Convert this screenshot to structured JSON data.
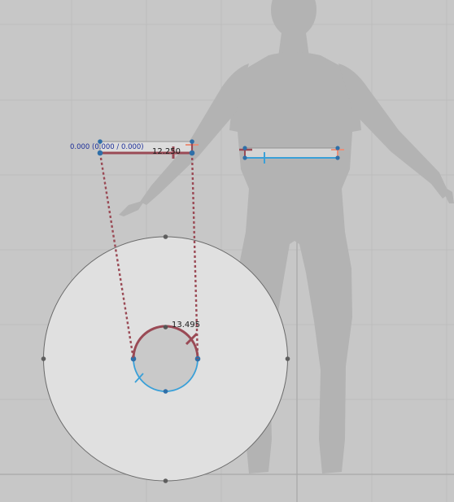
{
  "viewport": {
    "background": "#c7c7c7",
    "grid_color": "#b9b9b9",
    "axis_color": "#a5a5a5"
  },
  "labels": {
    "origin_readout": "0.000 (0.000 / 0.000)",
    "width_measure": "12.250",
    "arc_measure": "13.495"
  },
  "colors": {
    "measure_dark_red": "#9a4a55",
    "measure_blue": "#3aa0d8",
    "handle_blue": "#2f6fa8",
    "handle_gray": "#555555",
    "outer_circle_fill": "#e0e0e0",
    "body_silhouette": "#b3b3b3",
    "readout_text": "#1d2f9a"
  },
  "icons": {
    "silhouette": "human-body-silhouette-icon"
  }
}
